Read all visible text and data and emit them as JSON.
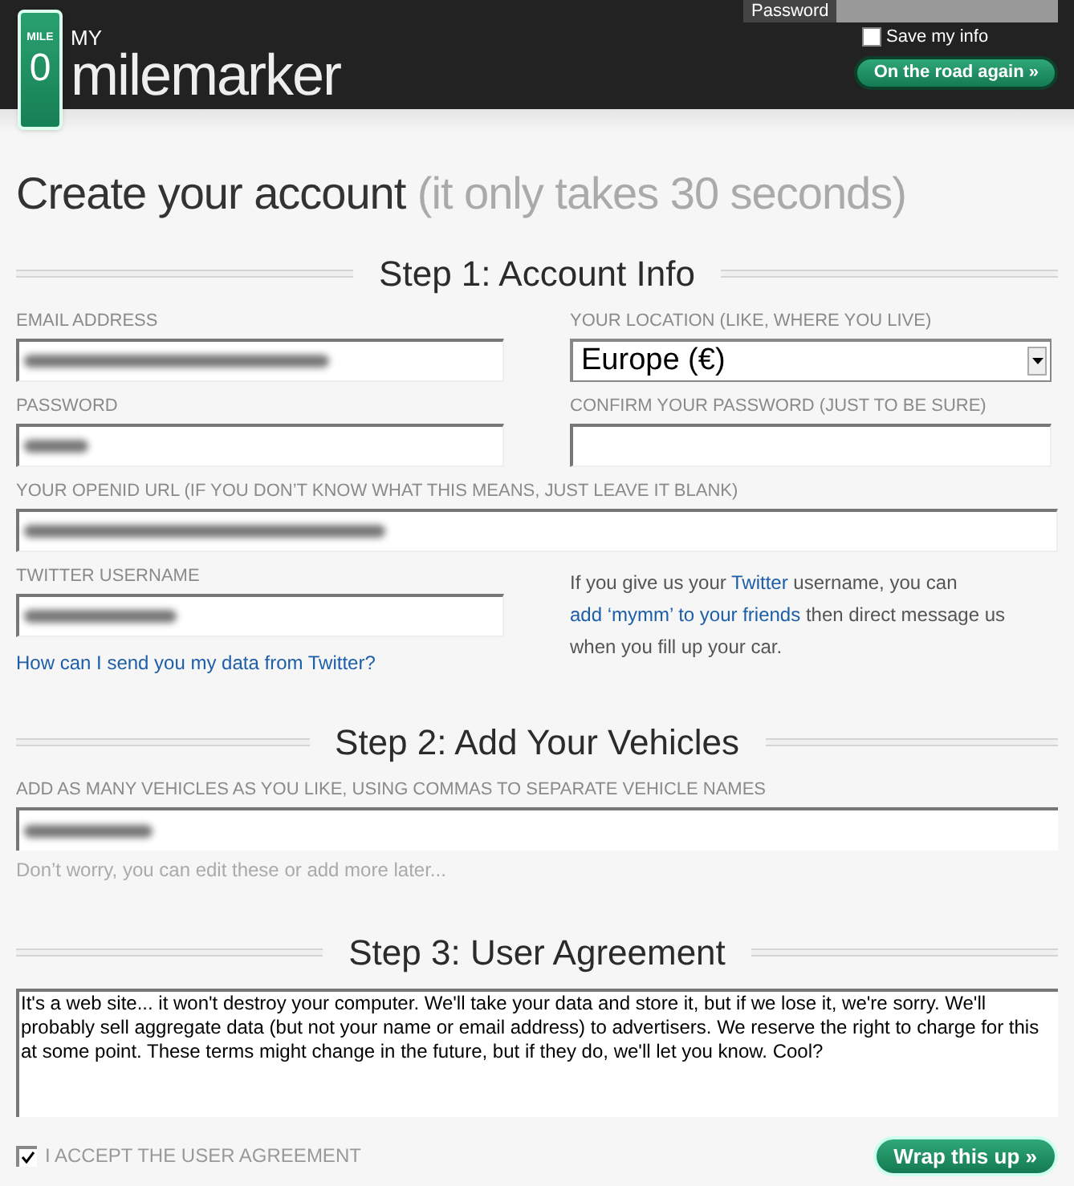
{
  "header": {
    "logo": {
      "sign_top": "MILE",
      "sign_number": "0",
      "brand_small": "MY",
      "brand": "milemarker"
    },
    "login": {
      "password_label": "Password",
      "remember": {
        "label": "Save my info",
        "checked": false
      },
      "button": "On the road again »"
    }
  },
  "title": {
    "main": "Create your account",
    "aside": "(it only takes 30 seconds)"
  },
  "step1": {
    "heading": "Step 1: Account Info",
    "fields": [
      {
        "label": "EMAIL ADDRESS",
        "kind": "text",
        "redacted": true
      },
      {
        "label": "YOUR LOCATION (LIKE, WHERE YOU LIVE)",
        "kind": "select",
        "value": "Europe (€)"
      },
      {
        "label": "PASSWORD",
        "kind": "text",
        "redacted": true
      },
      {
        "label": "CONFIRM YOUR PASSWORD (JUST TO BE SURE)",
        "kind": "text",
        "redacted": false
      },
      {
        "label": "YOUR OPENID URL (IF YOU DON’T KNOW WHAT THIS MEANS, JUST LEAVE IT BLANK)",
        "kind": "wide",
        "redacted": true
      },
      {
        "label": "TWITTER USERNAME",
        "kind": "text",
        "redacted": true
      }
    ],
    "twitter_link": "How can I send you my data from Twitter?",
    "twitter_note": [
      "If you give us your ",
      {
        "link": "Twitter"
      },
      " username, you can ",
      {
        "link": "add ‘mymm’ to your friends"
      },
      " then direct message us when you fill up your car."
    ]
  },
  "step2": {
    "heading": "Step 2: Add Your Vehicles",
    "field": {
      "label": "ADD AS MANY VEHICLES AS YOU LIKE, USING COMMAS TO SEPARATE VEHICLE NAMES",
      "redacted": true
    },
    "hint": "Don’t worry, you can edit these or add more later..."
  },
  "step3": {
    "heading": "Step 3: User Agreement",
    "agreement": "It's a web site... it won't destroy your computer. We'll take your data and store it, but if we lose it, we're sorry. We'll probably sell aggregate data (but not your name or email address) to advertisers. We reserve the right to charge for this at some point.  These terms might change in the future, but if they do, we'll let you know.  Cool?",
    "accept": {
      "label": "I ACCEPT THE USER AGREEMENT",
      "checked": true
    },
    "button": "Wrap this up »"
  }
}
